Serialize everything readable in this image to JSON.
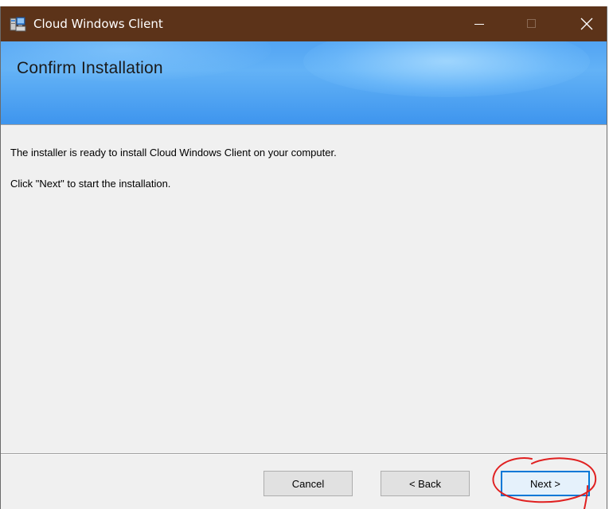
{
  "window": {
    "title": "Cloud Windows Client",
    "controls": {
      "minimize": "minimize-icon",
      "maximize": "maximize-icon",
      "close": "close-icon"
    }
  },
  "header": {
    "title": "Confirm Installation"
  },
  "body": {
    "line1": "The installer is ready to install Cloud Windows Client on your computer.",
    "line2": "Click \"Next\" to start the installation."
  },
  "buttons": {
    "cancel": "Cancel",
    "back": "< Back",
    "next": "Next >"
  },
  "colors": {
    "titlebar": "#5c3319",
    "banner": "#52a4f3",
    "focus_border": "#0078d7",
    "annotation": "#e02020"
  }
}
